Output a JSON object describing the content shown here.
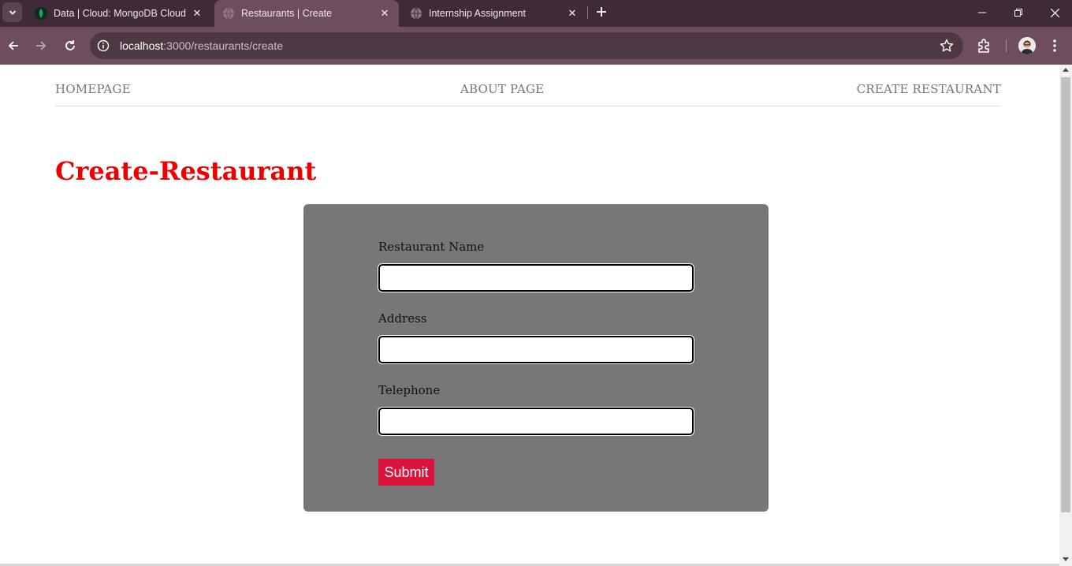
{
  "browser": {
    "tabs": [
      {
        "title": "Data | Cloud: MongoDB Cloud",
        "active": false,
        "favicon": "mongodb-leaf-icon"
      },
      {
        "title": "Restaurants | Create",
        "active": true,
        "favicon": "globe-icon"
      },
      {
        "title": "Internship Assignment",
        "active": false,
        "favicon": "globe-icon"
      }
    ],
    "address": {
      "host": "localhost",
      "path": ":3000/restaurants/create"
    },
    "colors": {
      "tabstrip": "#3e2b36",
      "toolbar": "#6e4e5e",
      "omnibox": "#4e3843"
    }
  },
  "page": {
    "nav": {
      "home": "HOMEPAGE",
      "about": "ABOUT PAGE",
      "create": "CREATE RESTAURANT"
    },
    "heading": "Create-Restaurant",
    "form": {
      "name_label": "Restaurant Name",
      "name_value": "",
      "address_label": "Address",
      "address_value": "",
      "telephone_label": "Telephone",
      "telephone_value": "",
      "submit_label": "Submit"
    },
    "colors": {
      "heading": "#ee0000",
      "card": "#777777",
      "submit": "#dc143c"
    }
  }
}
